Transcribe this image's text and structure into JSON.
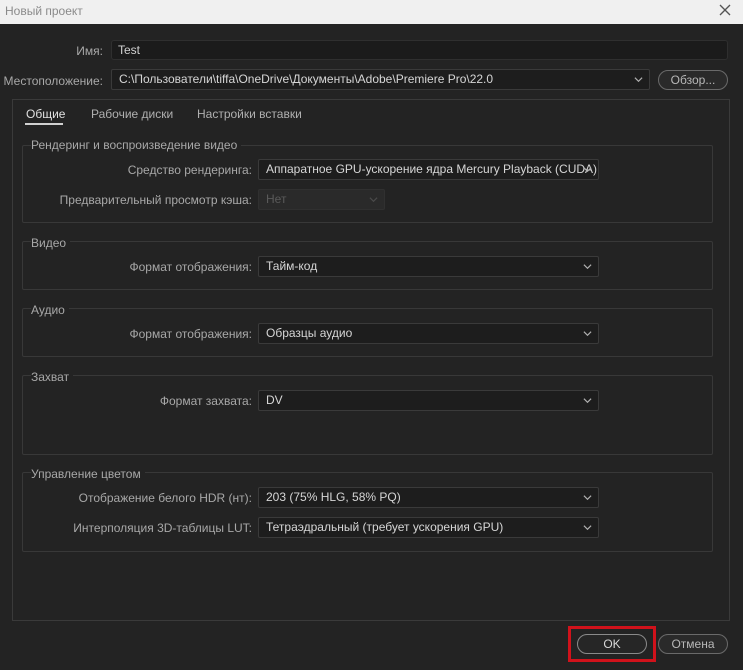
{
  "window": {
    "title": "Новый проект"
  },
  "name": {
    "label": "Имя:",
    "value": "Test"
  },
  "location": {
    "label": "Местоположение:",
    "value": "C:\\Пользователи\\tiffa\\OneDrive\\Документы\\Adobe\\Premiere Pro\\22.0",
    "browse_label": "Обзор..."
  },
  "tabs": [
    {
      "label": "Общие",
      "active": true
    },
    {
      "label": "Рабочие диски",
      "active": false
    },
    {
      "label": "Настройки вставки",
      "active": false
    }
  ],
  "rendering": {
    "title": "Рендеринг и воспроизведение видео",
    "renderer_label": "Средство рендеринга:",
    "renderer_value": "Аппаратное GPU-ускорение ядра Mercury Playback (CUDA)",
    "preview_cache_label": "Предварительный просмотр кэша:",
    "preview_cache_value": "Нет"
  },
  "video": {
    "title": "Видео",
    "display_format_label": "Формат отображения:",
    "display_format_value": "Тайм-код"
  },
  "audio": {
    "title": "Аудио",
    "display_format_label": "Формат отображения:",
    "display_format_value": "Образцы аудио"
  },
  "capture": {
    "title": "Захват",
    "format_label": "Формат захвата:",
    "format_value": "DV"
  },
  "color": {
    "title": "Управление цветом",
    "hdr_white_label": "Отображение белого HDR (нт):",
    "hdr_white_value": "203 (75% HLG, 58% PQ)",
    "lut_label": "Интерполяция 3D-таблицы LUT:",
    "lut_value": "Тетраэдральный (требует ускорения GPU)"
  },
  "footer": {
    "ok_label": "OK",
    "cancel_label": "Отмена"
  },
  "colors": {
    "background": "#232323",
    "highlight": "#d0121b"
  }
}
